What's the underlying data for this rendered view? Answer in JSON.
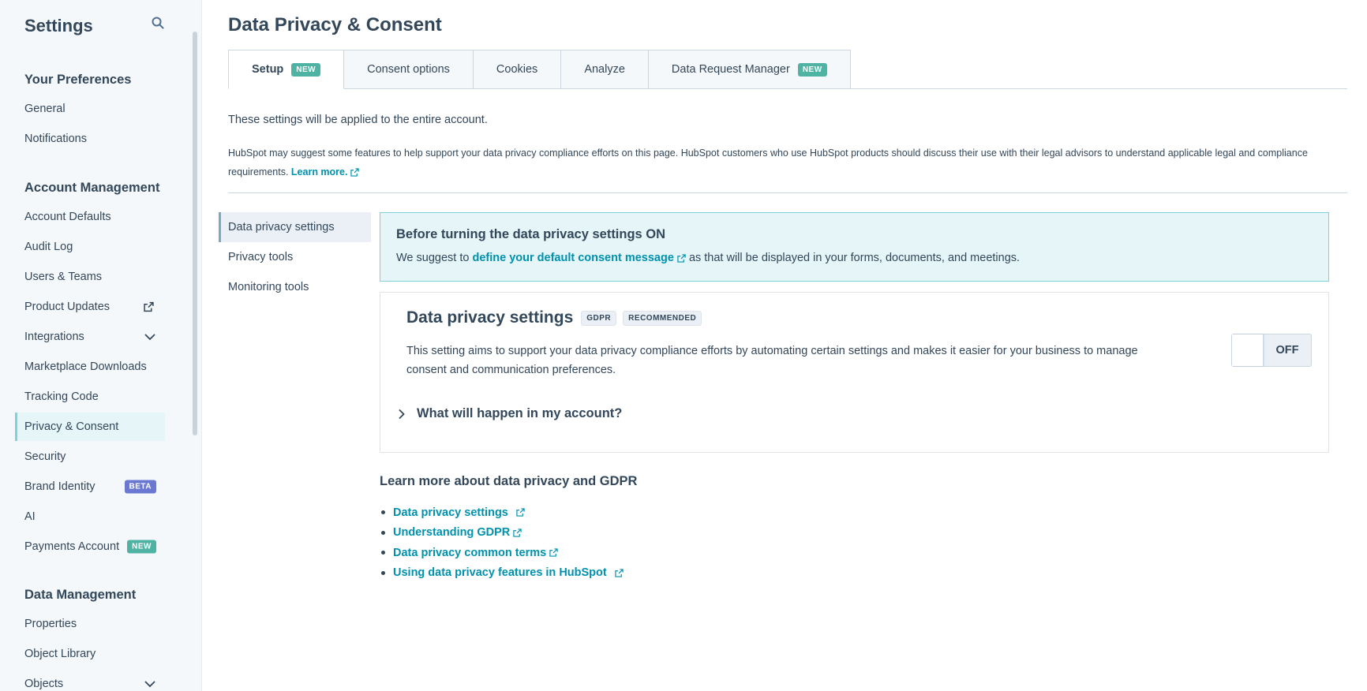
{
  "sidebar": {
    "title": "Settings",
    "sections": {
      "preferences": "Your Preferences",
      "account": "Account Management",
      "data": "Data Management"
    },
    "items": {
      "general": "General",
      "notifications": "Notifications",
      "account_defaults": "Account Defaults",
      "audit_log": "Audit Log",
      "users_teams": "Users & Teams",
      "product_updates": "Product Updates",
      "integrations": "Integrations",
      "marketplace_downloads": "Marketplace Downloads",
      "tracking_code": "Tracking Code",
      "privacy_consent": "Privacy & Consent",
      "security": "Security",
      "brand_identity": "Brand Identity",
      "ai": "AI",
      "payments_account": "Payments Account",
      "properties": "Properties",
      "object_library": "Object Library",
      "objects": "Objects"
    },
    "badges": {
      "beta": "BETA",
      "new": "NEW"
    }
  },
  "page": {
    "title": "Data Privacy & Consent"
  },
  "tabs": {
    "setup": "Setup",
    "consent_options": "Consent options",
    "cookies": "Cookies",
    "analyze": "Analyze",
    "data_request_manager": "Data Request Manager",
    "new_badge": "NEW"
  },
  "intro": {
    "applies": "These settings will be applied to the entire account.",
    "disclaimer": "HubSpot may suggest some features to help support your data privacy compliance efforts on this page. HubSpot customers who use HubSpot products should discuss their use with their legal advisors to understand applicable legal and compliance requirements.",
    "learn_more": "Learn more."
  },
  "subnav": {
    "data_privacy_settings": "Data privacy settings",
    "privacy_tools": "Privacy tools",
    "monitoring_tools": "Monitoring tools"
  },
  "callout": {
    "title": "Before turning the data privacy settings ON",
    "prefix": "We suggest to",
    "link": "define your default consent message",
    "suffix": "as that will be displayed in your forms, documents, and meetings."
  },
  "card": {
    "title": "Data privacy settings",
    "badge_gdpr": "GDPR",
    "badge_recommended": "RECOMMENDED",
    "description": "This setting aims to support your data privacy compliance efforts by automating certain settings and makes it easier for your business to manage consent and communication preferences.",
    "toggle_label": "OFF",
    "accordion": "What will happen in my account?"
  },
  "learn": {
    "title": "Learn more about data privacy and GDPR",
    "links": {
      "l1": "Data privacy settings",
      "l2": "Understanding GDPR",
      "l3": "Data privacy common terms",
      "l4": "Using data privacy features in HubSpot"
    }
  },
  "colors": {
    "text": "#33475b",
    "link": "#0091ae",
    "accent": "#7fd1de",
    "badge_new": "#00bda5",
    "badge_beta": "#6a78d1"
  }
}
